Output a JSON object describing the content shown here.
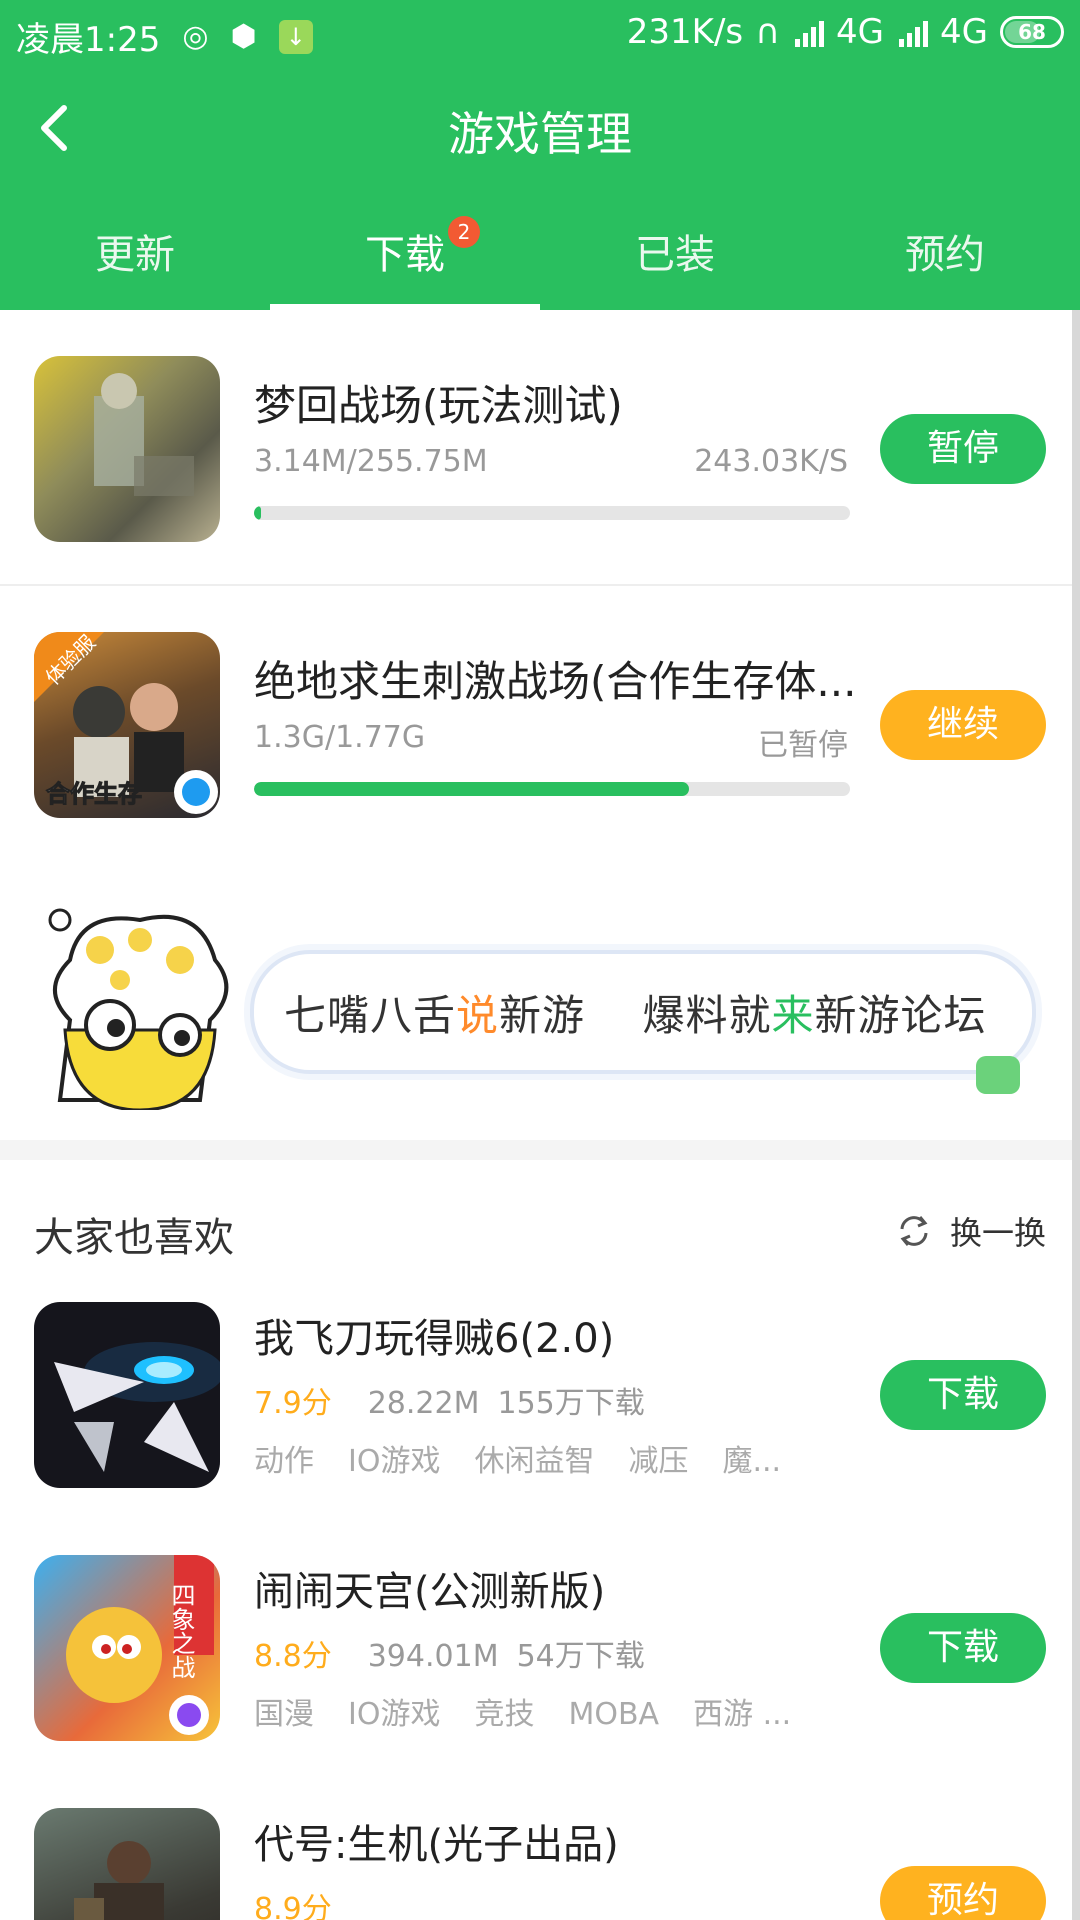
{
  "status_bar": {
    "time": "凌晨1:25",
    "net_speed": "231K/s",
    "network1": "4G",
    "network2": "4G",
    "battery": "68"
  },
  "header": {
    "title": "游戏管理",
    "tabs": [
      {
        "label": "更新"
      },
      {
        "label": "下载",
        "badge": "2"
      },
      {
        "label": "已装"
      },
      {
        "label": "预约"
      }
    ],
    "active_tab": "下载"
  },
  "downloads": [
    {
      "title": "梦回战场(玩法测试)",
      "size": "3.14M/255.75M",
      "status": "243.03K/S",
      "progress": 0.012,
      "button": "暂停",
      "button_color": "#29bf5f"
    },
    {
      "title": "绝地求生刺激战场(合作生存体...",
      "size": "1.3G/1.77G",
      "status": "已暂停",
      "progress": 0.73,
      "button": "继续",
      "button_color": "#ffb21f",
      "thumb_labels": [
        "体验服",
        "合作生存"
      ]
    }
  ],
  "banner": {
    "text_a1": "七嘴八舌",
    "text_a2": "说",
    "text_a3": "新游",
    "text_b1": "爆料就",
    "text_b2": "来",
    "text_b3": "新游论坛"
  },
  "recommend": {
    "title": "大家也喜欢",
    "refresh_label": "换一换",
    "items": [
      {
        "title": "我飞刀玩得贼6(2.0)",
        "score": "7.9分",
        "size": "28.22M",
        "downloads": "155万下载",
        "tags": [
          "动作",
          "IO游戏",
          "休闲益智",
          "减压",
          "魔..."
        ],
        "button": "下载",
        "button_color": "#29bf5f"
      },
      {
        "title": "闹闹天宫(公测新版)",
        "score": "8.8分",
        "size": "394.01M",
        "downloads": "54万下载",
        "tags": [
          "国漫",
          "IO游戏",
          "竞技",
          "MOBA",
          "西游 ..."
        ],
        "button": "下载",
        "button_color": "#29bf5f",
        "thumb_label": "四象之战"
      },
      {
        "title": "代号:生机(光子出品)",
        "score": "8.9分",
        "button": "预约",
        "button_color": "#ffb21f"
      }
    ]
  },
  "colors": {
    "brand_green": "#29bf5f",
    "accent_orange": "#ffb21f",
    "badge_red": "#f25a33"
  }
}
